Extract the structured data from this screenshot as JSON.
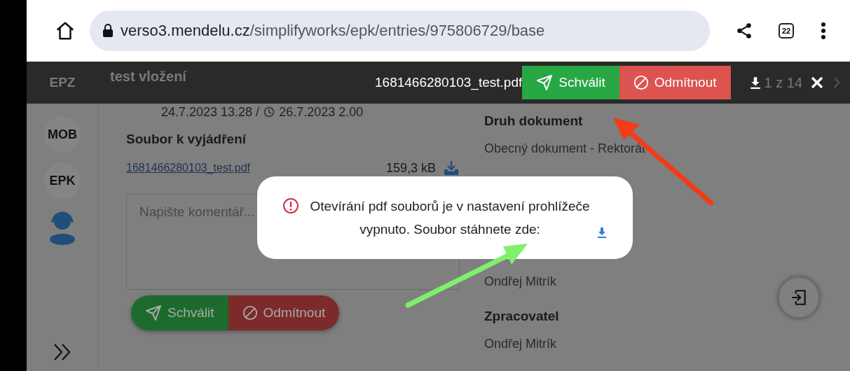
{
  "browser": {
    "url_host": "verso3.mendelu.cz",
    "url_path": "/simplifyworks/epk/entries/975806729/base",
    "tab_count": "22"
  },
  "viewer_bar": {
    "filename": "1681466280103_test.pdf",
    "approve_label": "Schválit",
    "reject_label": "Odmítnout",
    "page_counter": "1 z 14"
  },
  "app_header": {
    "section": "EPZ",
    "title": "test vložení",
    "created": "24.7.2023 13.28 /",
    "deadline": "26.7.2023 2.00"
  },
  "sidebar": {
    "items": [
      {
        "label": "MOB"
      },
      {
        "label": "EPK"
      }
    ]
  },
  "file_section": {
    "heading": "Soubor k vyjádření",
    "file_link": "1681466280103_test.pdf",
    "file_size": "159,3 kB",
    "comment_placeholder": "Napište komentář...",
    "approve_label": "Schválit",
    "reject_label": "Odmítnout"
  },
  "details": [
    {
      "kind": "label",
      "text": "Druh dokument"
    },
    {
      "kind": "value",
      "text": "Obecný dokument - Rektorát"
    },
    {
      "kind": "spacer"
    },
    {
      "kind": "value",
      "text": "Ondřej Mitrík"
    },
    {
      "kind": "label",
      "text": "Zpracovatel"
    },
    {
      "kind": "value",
      "text": "Ondřej Mitrík"
    }
  ],
  "dialog": {
    "message": "Otevírání pdf souborů je v nastavení prohlížeče vypnuto. Soubor stáhnete zde:"
  }
}
